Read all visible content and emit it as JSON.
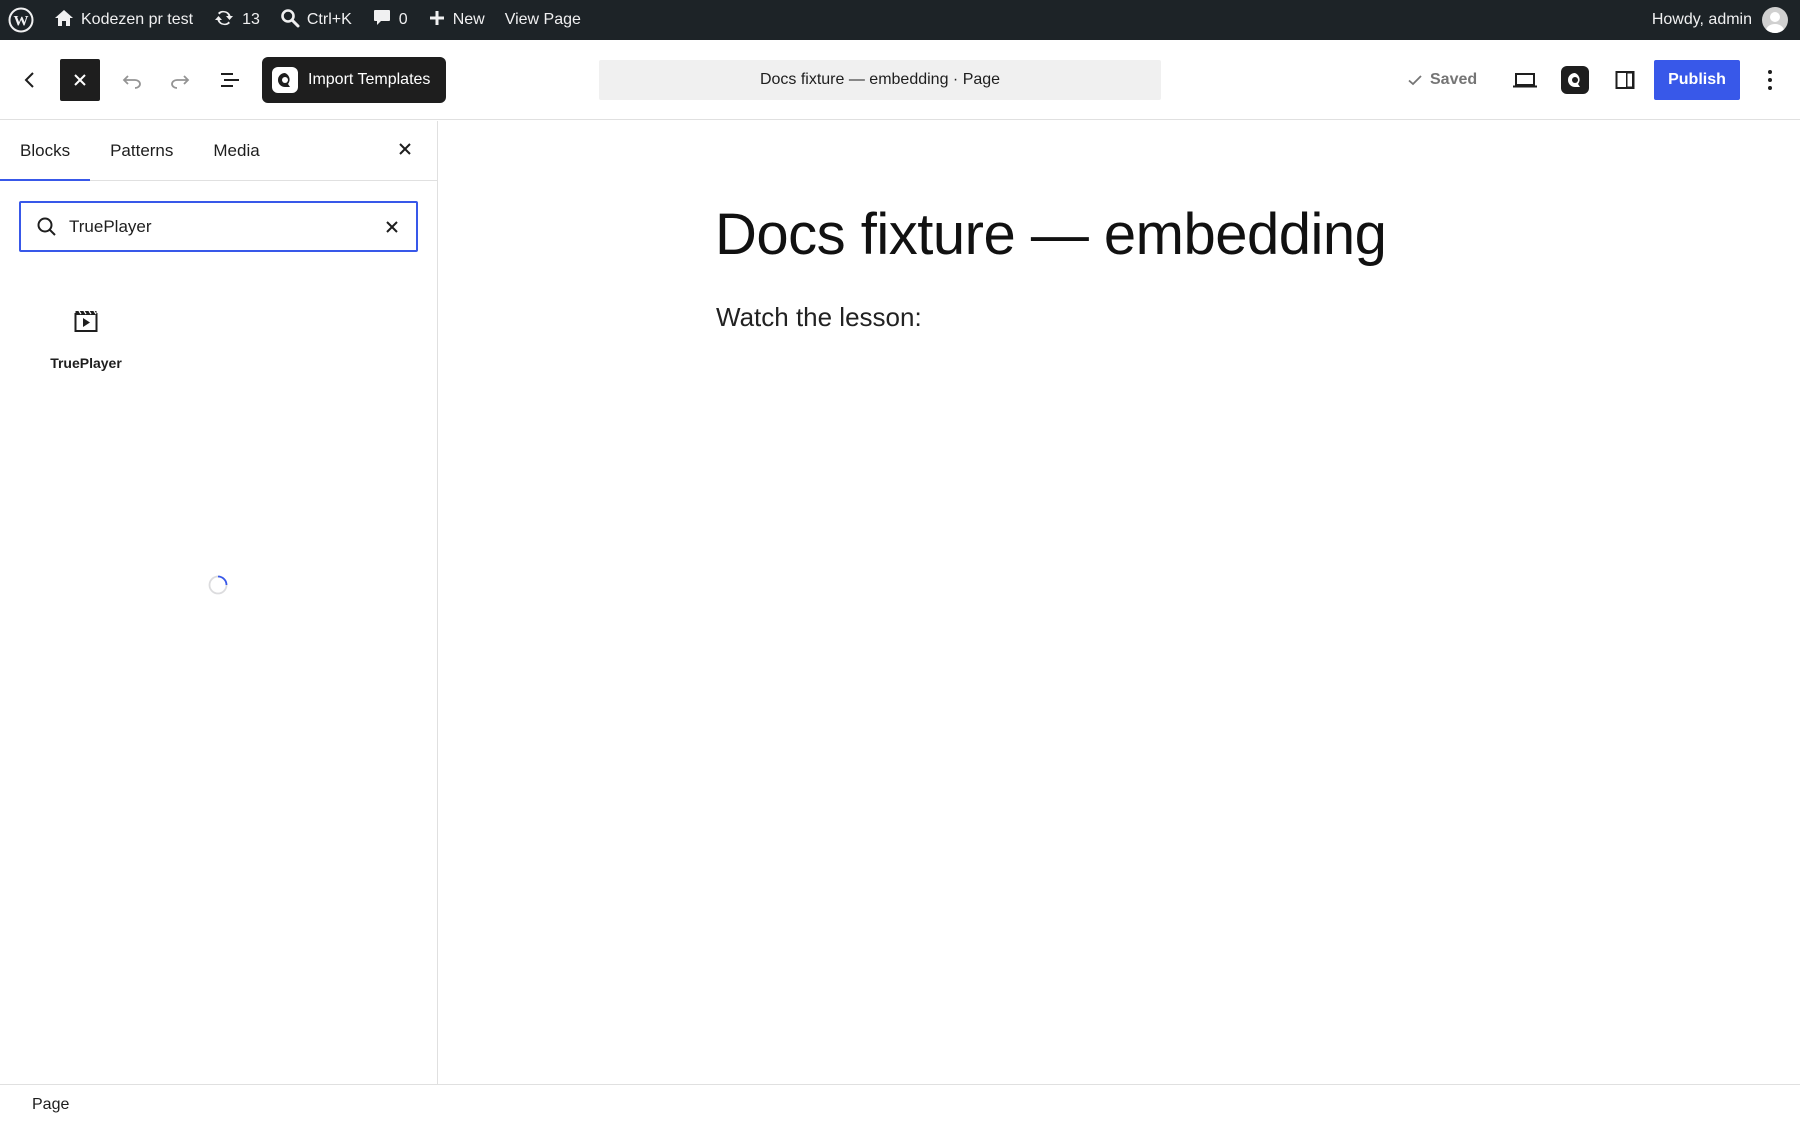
{
  "admin_bar": {
    "site_name": "Kodezen pr test",
    "updates_count": "13",
    "search_shortcut": "Ctrl+K",
    "comments_count": "0",
    "new_label": "New",
    "view_label": "View Page",
    "greeting": "Howdy, admin"
  },
  "header": {
    "import_label": "Import Templates",
    "document_title": "Docs fixture — embedding · Page",
    "saved_label": "Saved",
    "publish_label": "Publish"
  },
  "inserter": {
    "tabs": [
      {
        "label": "Blocks",
        "active": true
      },
      {
        "label": "Patterns",
        "active": false
      },
      {
        "label": "Media",
        "active": false
      }
    ],
    "search_value": "TruePlayer",
    "results": [
      {
        "label": "TruePlayer",
        "icon": "video-block-icon"
      }
    ]
  },
  "canvas": {
    "title": "Docs fixture — embedding",
    "paragraph": "Watch the lesson:"
  },
  "footer": {
    "breadcrumb": "Page"
  },
  "colors": {
    "admin_bar": "#1d2327",
    "accent": "#3858e9",
    "dark": "#1e1e1e"
  }
}
